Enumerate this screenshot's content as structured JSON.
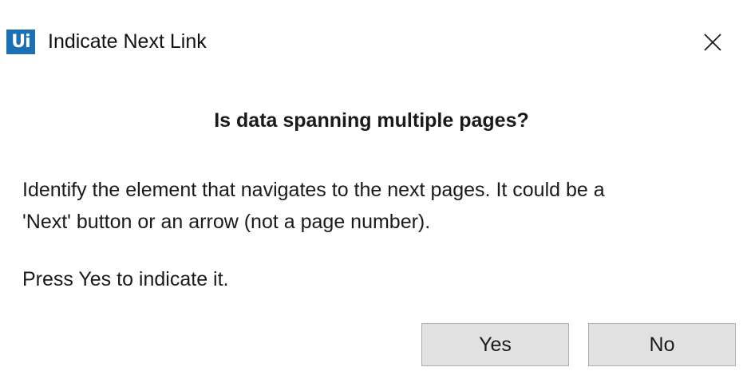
{
  "titlebar": {
    "logo_text": "Ui",
    "title": "Indicate Next Link",
    "close_icon": "close-icon"
  },
  "content": {
    "heading": "Is data spanning multiple pages?",
    "message_lines": [
      "Identify the element that navigates to the next pages. It could be a",
      "'Next' button or an arrow (not a page number)."
    ],
    "instruction": "Press Yes to indicate it."
  },
  "buttons": {
    "yes_label": "Yes",
    "no_label": "No"
  },
  "colors": {
    "logo_bg": "#1a6fb5",
    "button_bg": "#e1e1e1",
    "button_border": "#adadad"
  }
}
